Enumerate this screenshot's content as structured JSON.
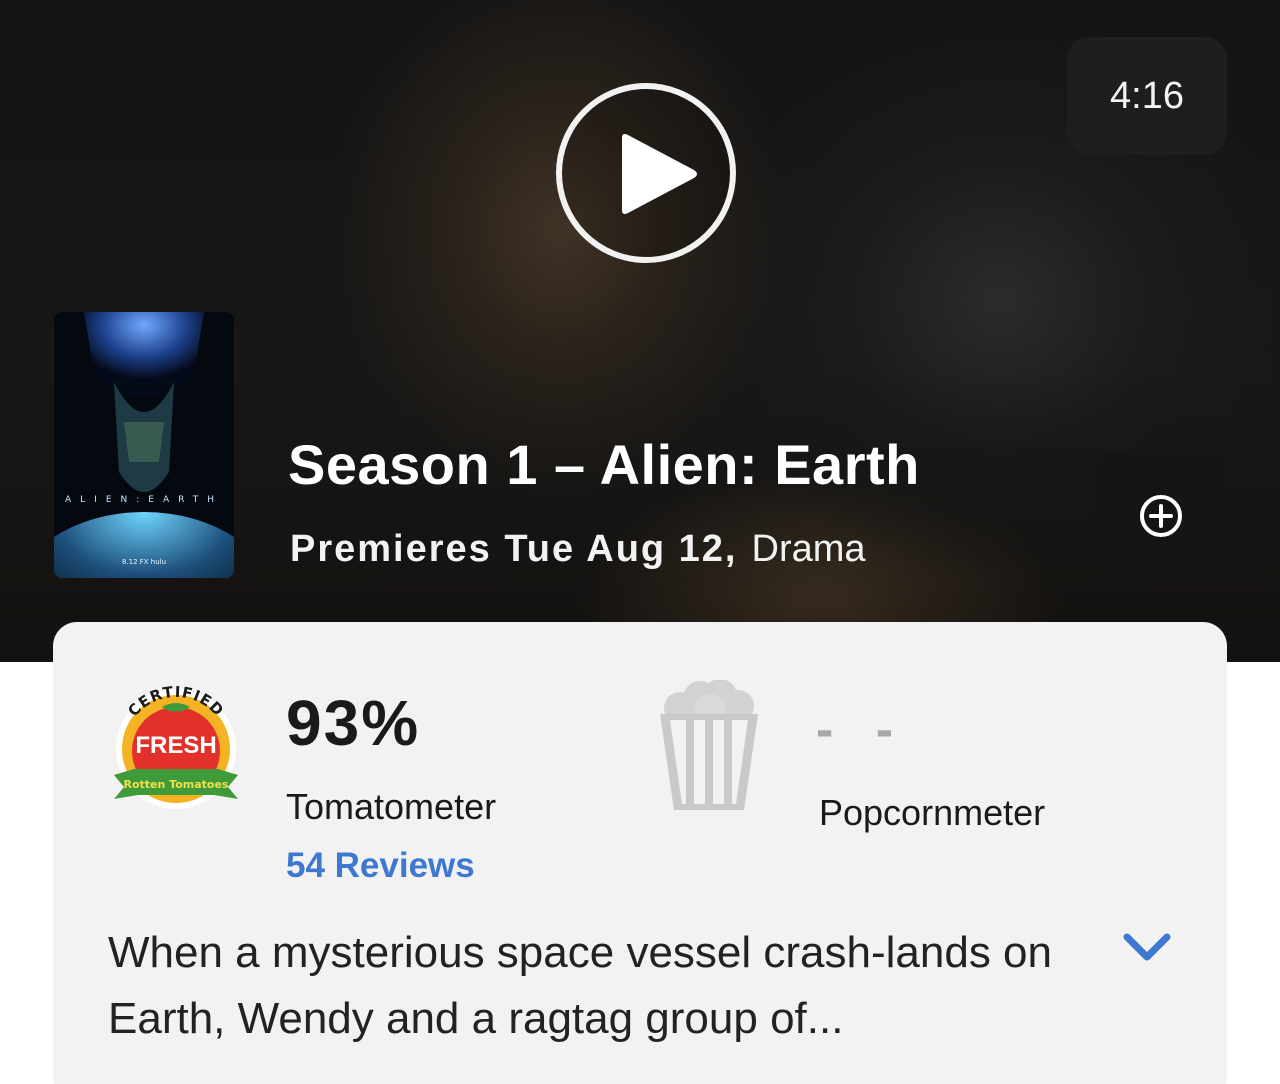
{
  "hero": {
    "duration": "4:16",
    "title": "Season 1 – Alien: Earth",
    "premiere": "Premieres Tue Aug 12,",
    "genre": "Drama"
  },
  "poster": {
    "title_art": "ALIEN:EARTH",
    "date_mark": "8.12 FX hulu"
  },
  "scores": {
    "tomatometer_badge_top": "CERTIFIED",
    "tomatometer_badge_main": "FRESH",
    "tomatometer_badge_bottom": "Rotten Tomatoes",
    "tomatometer_value": "93%",
    "tomatometer_label": "Tomatometer",
    "reviews_link": "54 Reviews",
    "popcornmeter_value": "- -",
    "popcornmeter_label": "Popcornmeter"
  },
  "synopsis": {
    "text": "When a mysterious space vessel crash-lands on Earth, Wendy and a ragtag group of..."
  },
  "colors": {
    "link": "#3f78d1",
    "fresh_red": "#e1312a",
    "fresh_green": "#3f9b3a",
    "fresh_yellow": "#f4b324"
  }
}
